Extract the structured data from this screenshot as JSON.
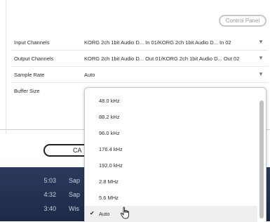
{
  "header": {
    "control_panel_label": "Control Panel"
  },
  "settings": {
    "rows": [
      {
        "label": "Input Channels",
        "value": "KORG 2ch 1bit Audio D... In 01/KORG 2ch 1bit Audio D... In 02"
      },
      {
        "label": "Output Channels",
        "value": "KORG 2ch 1bit Audio D... Out 01/KORG 2ch 1bit Audio D... Out 02"
      },
      {
        "label": "Sample Rate",
        "value": "Auto"
      },
      {
        "label": "Buffer Size",
        "value": ""
      }
    ],
    "arrow_glyph": "▼"
  },
  "footer": {
    "cancel_label": "CA"
  },
  "playlist": {
    "rows": [
      {
        "time": "5:03",
        "title": "Sap"
      },
      {
        "time": "4:32",
        "title": "Sap"
      },
      {
        "time": "3:40",
        "title": "Wis"
      }
    ]
  },
  "dropdown": {
    "options": [
      "48.0 kHz",
      "88.2 kHz",
      "96.0 kHz",
      "176.4 kHz",
      "192.0 kHz",
      "2.8 MHz",
      "5.6 MHz",
      "Auto"
    ],
    "selected": "Auto",
    "check_glyph": "✔"
  },
  "colors": {
    "playlist_bg": "#2b3a5c",
    "selected_bg": "#efefef"
  },
  "icons": {
    "cursor": "hand-pointer-icon",
    "check": "checkmark-icon",
    "arrow": "chevron-down-icon"
  }
}
